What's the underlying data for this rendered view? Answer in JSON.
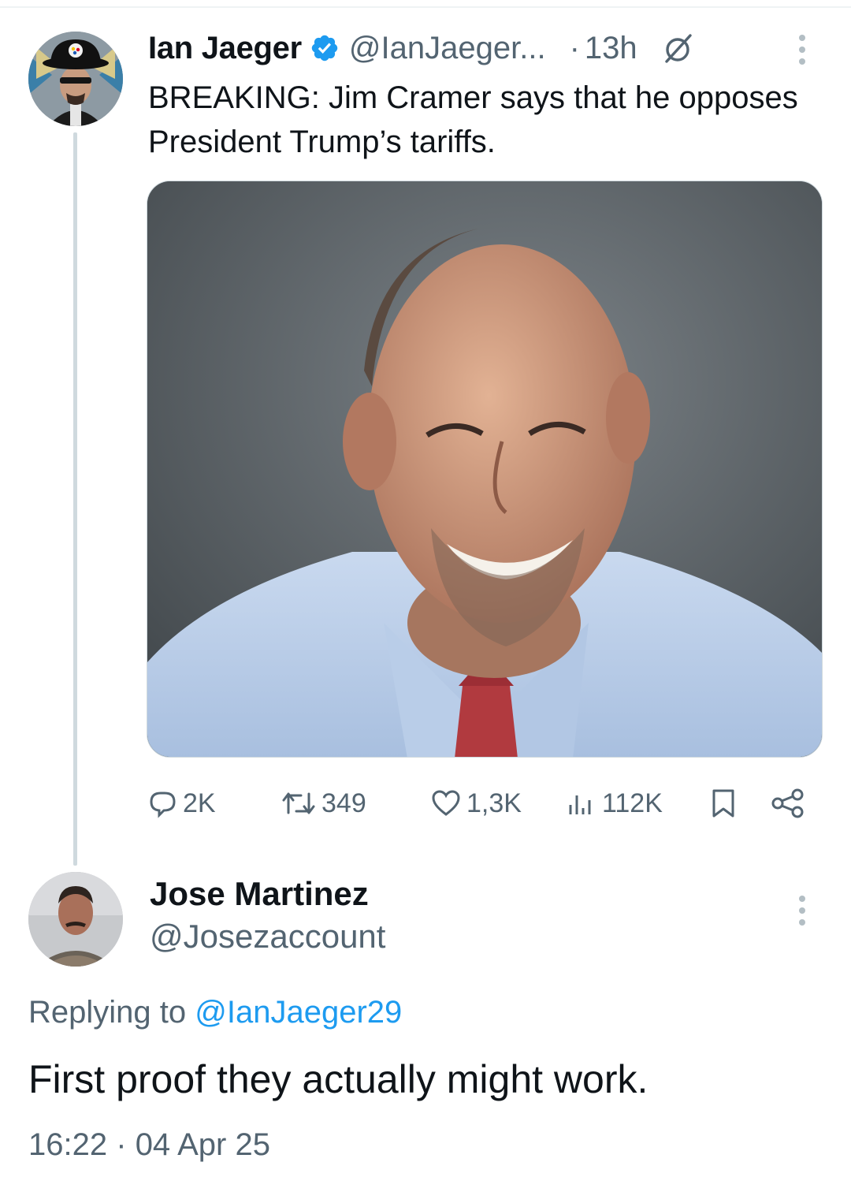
{
  "parent_tweet": {
    "author_name": "Ian Jaeger",
    "author_handle": "@IanJaeger...",
    "separator": "·",
    "time": "13h",
    "text": "BREAKING: Jim Cramer says that he opposes President Trump’s tariffs.",
    "verified": true,
    "actions": {
      "replies": "2K",
      "reposts": "349",
      "likes": "1,3K",
      "views": "112K"
    }
  },
  "reply": {
    "author_name": "Jose Martinez",
    "author_handle": "@Josezaccount",
    "replying_prefix": "Replying to",
    "replying_mention": "@IanJaeger29",
    "text": "First proof they actually might work.",
    "time": "16:22",
    "separator": "·",
    "date": "04 Apr 25"
  },
  "colors": {
    "accent": "#1d9bf0",
    "text_primary": "#0f1419",
    "text_secondary": "#536471",
    "thread_line": "#cfd9de"
  },
  "icons": [
    "verified-badge-icon",
    "grok-icon",
    "more-options-icon",
    "reply-icon",
    "repost-icon",
    "like-icon",
    "views-icon",
    "bookmark-icon",
    "share-icon"
  ]
}
